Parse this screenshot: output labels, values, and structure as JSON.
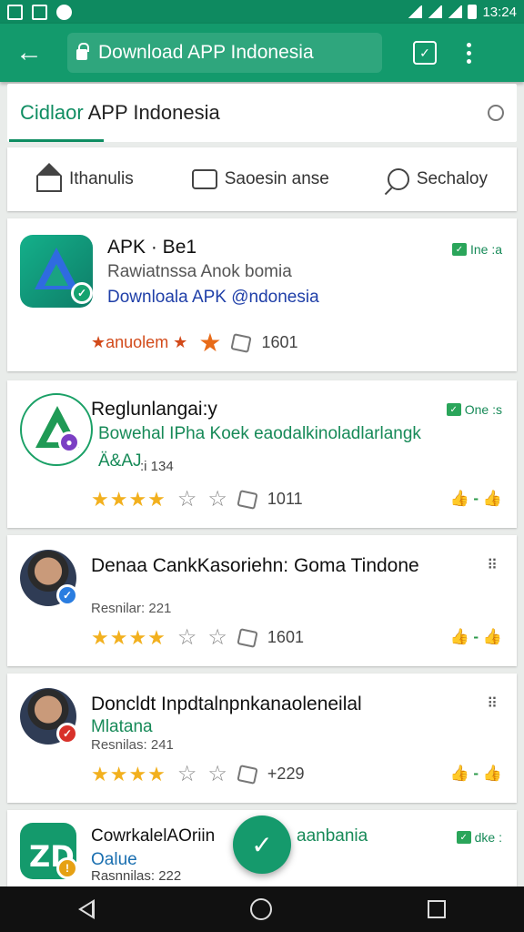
{
  "status_bar": {
    "time": "13:24"
  },
  "app_bar": {
    "url": "Download APP Indonesia",
    "tab_count": "✓"
  },
  "header": {
    "title_accent": "Cidlaor",
    "title_rest": " APP Indonesia"
  },
  "filters": [
    {
      "label": "Ithanulis"
    },
    {
      "label": "Saoesin anse"
    },
    {
      "label": "Sechaloy"
    }
  ],
  "cards": [
    {
      "title": "APK · Be1",
      "subtitle": "Rawiatnssa Anok bomia",
      "link": "Downloala APK @ndonesia",
      "tag": "Ine :a",
      "promo": "★anuolem ★",
      "rating_count": "1601"
    },
    {
      "title": "Reglunlangai:y",
      "subtitle": "Bowehal IPha Koek eaodalkinoladlarlangk",
      "extra": "Ä&AJ",
      "extra_small": ":i 134",
      "tag": "One :s",
      "rating_stars": "★★★★",
      "rating_count": "1011",
      "thumbs": "👍 - 👍"
    },
    {
      "title": "Denaa CankKasoriehn: Goma Tindone",
      "subtitle": "Resnilar: 221",
      "rating_stars": "★★★★",
      "rating_count": "1601",
      "thumbs": "👍 - 👍"
    },
    {
      "title": "Doncldt Inpdtalnpnkanaoleneilal",
      "subtitle_green": "Mlatana",
      "subtitle": "Resnilas: 241",
      "rating_stars": "★★★★",
      "rating_count": "+229",
      "thumbs": "👍 - 👍"
    },
    {
      "title": "CowrkalelAOriin",
      "title_tail": "aanbania",
      "subtitle_green": "Oalue",
      "subtitle": "Rasnnilas: 222",
      "tag": "dke :"
    }
  ],
  "colors": {
    "primary": "#139a6c",
    "status_bar": "#0e8a60",
    "star": "#f2b01e",
    "link": "#1f3fa8",
    "green_text": "#178a58"
  }
}
